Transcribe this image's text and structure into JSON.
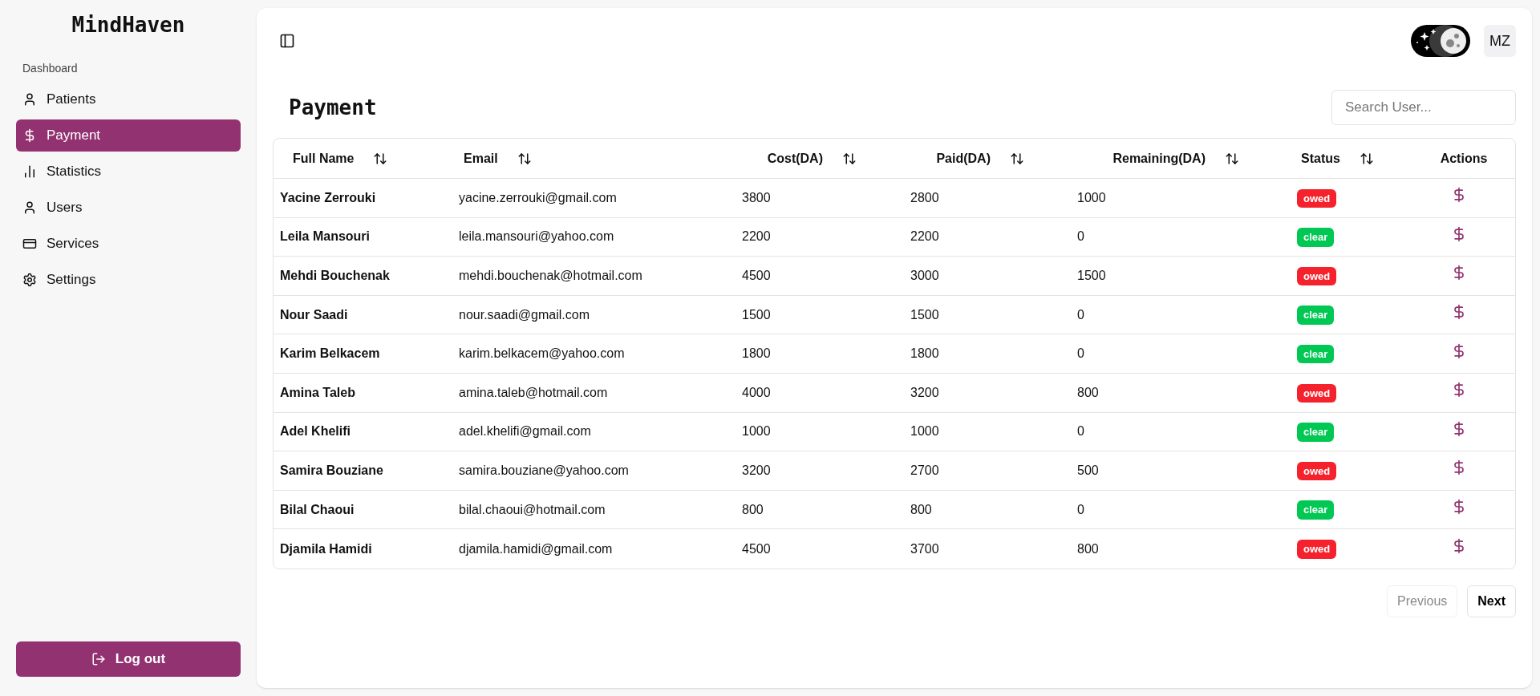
{
  "sidebar": {
    "logo": "MindHaven",
    "section": "Dashboard",
    "items": [
      {
        "label": "Patients",
        "selected": false
      },
      {
        "label": "Payment",
        "selected": true
      },
      {
        "label": "Statistics",
        "selected": false
      },
      {
        "label": "Users",
        "selected": false
      },
      {
        "label": "Services",
        "selected": false
      },
      {
        "label": "Settings",
        "selected": false
      }
    ],
    "logout": "Log out"
  },
  "header": {
    "avatar": "MZ"
  },
  "page": {
    "title": "Payment",
    "search": {
      "placeholder": "Search User..."
    }
  },
  "table": {
    "columns": [
      {
        "label": "Full Name",
        "sortable": true
      },
      {
        "label": "Email",
        "sortable": true
      },
      {
        "label": "Cost(DA)",
        "sortable": true
      },
      {
        "label": "Paid(DA)",
        "sortable": true
      },
      {
        "label": "Remaining(DA)",
        "sortable": true
      },
      {
        "label": "Status",
        "sortable": true
      },
      {
        "label": "Actions",
        "sortable": false
      }
    ],
    "rows": [
      {
        "name": "Yacine Zerrouki",
        "email": "yacine.zerrouki@gmail.com",
        "cost": "3800",
        "paid": "2800",
        "remaining": "1000",
        "status": {
          "label": "owed",
          "kind": "owed"
        }
      },
      {
        "name": "Leila Mansouri",
        "email": "leila.mansouri@yahoo.com",
        "cost": "2200",
        "paid": "2200",
        "remaining": "0",
        "status": {
          "label": "clear",
          "kind": "clear"
        }
      },
      {
        "name": "Mehdi Bouchenak",
        "email": "mehdi.bouchenak@hotmail.com",
        "cost": "4500",
        "paid": "3000",
        "remaining": "1500",
        "status": {
          "label": "owed",
          "kind": "owed"
        }
      },
      {
        "name": "Nour Saadi",
        "email": "nour.saadi@gmail.com",
        "cost": "1500",
        "paid": "1500",
        "remaining": "0",
        "status": {
          "label": "clear",
          "kind": "clear"
        }
      },
      {
        "name": "Karim Belkacem",
        "email": "karim.belkacem@yahoo.com",
        "cost": "1800",
        "paid": "1800",
        "remaining": "0",
        "status": {
          "label": "clear",
          "kind": "clear"
        }
      },
      {
        "name": "Amina Taleb",
        "email": "amina.taleb@hotmail.com",
        "cost": "4000",
        "paid": "3200",
        "remaining": "800",
        "status": {
          "label": "owed",
          "kind": "owed"
        }
      },
      {
        "name": "Adel Khelifi",
        "email": "adel.khelifi@gmail.com",
        "cost": "1000",
        "paid": "1000",
        "remaining": "0",
        "status": {
          "label": "clear",
          "kind": "clear"
        }
      },
      {
        "name": "Samira Bouziane",
        "email": "samira.bouziane@yahoo.com",
        "cost": "3200",
        "paid": "2700",
        "remaining": "500",
        "status": {
          "label": "owed",
          "kind": "owed"
        }
      },
      {
        "name": "Bilal Chaoui",
        "email": "bilal.chaoui@hotmail.com",
        "cost": "800",
        "paid": "800",
        "remaining": "0",
        "status": {
          "label": "clear",
          "kind": "clear"
        }
      },
      {
        "name": "Djamila Hamidi",
        "email": "djamila.hamidi@gmail.com",
        "cost": "4500",
        "paid": "3700",
        "remaining": "800",
        "status": {
          "label": "owed",
          "kind": "owed"
        }
      }
    ]
  },
  "pagination": {
    "previous": {
      "label": "Previous",
      "disabled": true
    },
    "next": {
      "label": "Next",
      "disabled": false
    }
  }
}
